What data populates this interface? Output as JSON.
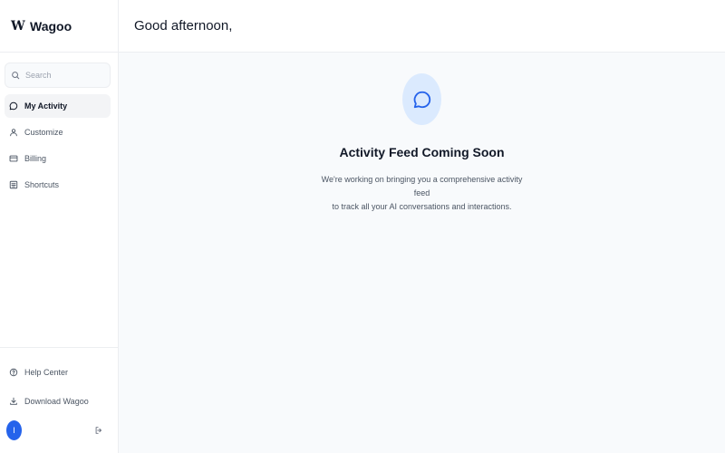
{
  "brand": {
    "logo": "W",
    "name": "Wagoo"
  },
  "search": {
    "placeholder": "Search",
    "icon": "search-icon"
  },
  "sidebar": {
    "items": [
      {
        "label": "My Activity",
        "icon": "chat-bubble-icon",
        "active": true
      },
      {
        "label": "Customize",
        "icon": "user-icon",
        "active": false
      },
      {
        "label": "Billing",
        "icon": "credit-card-icon",
        "active": false
      },
      {
        "label": "Shortcuts",
        "icon": "keyboard-icon",
        "active": false
      }
    ],
    "bottom": [
      {
        "label": "Help Center",
        "icon": "help-circle-icon"
      },
      {
        "label": "Download Wagoo",
        "icon": "download-icon"
      }
    ],
    "user": {
      "initial": "I",
      "avatar_color": "#2563eb"
    }
  },
  "header": {
    "greeting": "Good afternoon,"
  },
  "main": {
    "empty_state": {
      "icon": "chat-bubble-icon",
      "title": "Activity Feed Coming Soon",
      "description_line1": "We're working on bringing you a comprehensive activity feed",
      "description_line2": "to track all your AI conversations and interactions."
    }
  },
  "colors": {
    "accent": "#2563eb",
    "icon_bg": "#dbeafe",
    "content_bg": "#f8fafc",
    "active_item_bg": "#f3f4f6"
  }
}
